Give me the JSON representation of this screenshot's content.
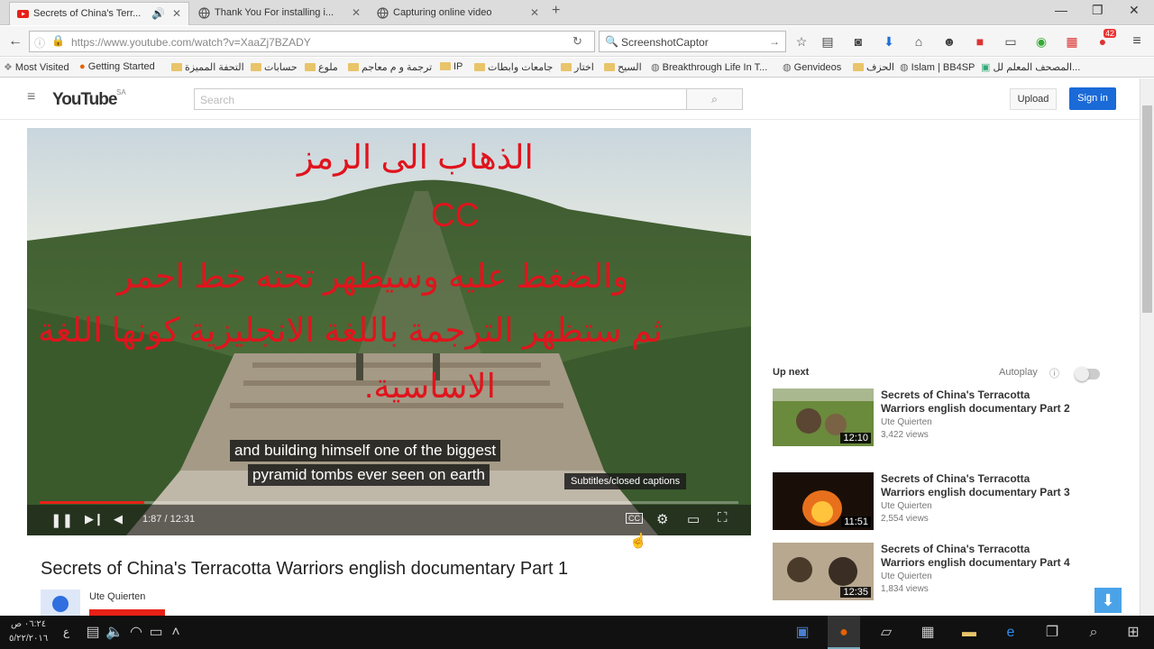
{
  "browser": {
    "tabs": [
      {
        "label": "Secrets of China's Terr...",
        "active": true
      },
      {
        "label": "Thank You For installing i...",
        "active": false
      },
      {
        "label": "Capturing online video",
        "active": false
      }
    ],
    "url": "https://www.youtube.com/watch?v=XaaZj7BZADY",
    "search_text": "ScreenshotCaptor",
    "notification_count": "42",
    "bookmarks": [
      "Most Visited",
      "Getting Started",
      "التحفة المميزة",
      "حسابات",
      "ملوع",
      "ترجمة و م معاجم",
      "IP",
      "جامعات وابطات",
      "اختار",
      "السيح",
      "Breakthrough Life In T...",
      "Genvideos",
      "الحزف",
      "Islam | BB4SP",
      "المصحف المعلم لل..."
    ]
  },
  "youtube": {
    "logo_text": "YouTube",
    "logo_region": "SA",
    "search_placeholder": "Search",
    "upload_label": "Upload",
    "signin_label": "Sign in"
  },
  "video": {
    "overlay_lines": [
      "الذهاب الى الرمز",
      "CC",
      "والضغط عليه وسيظهر تحته خط احمر",
      "ثم ستظهر الترجمة باللغة الانجليزية كونها اللغة",
      "الاساسية."
    ],
    "subtitle_line1": "and building himself one of the biggest",
    "subtitle_line2": "pyramid tombs ever seen on earth",
    "tooltip": "Subtitles/closed captions",
    "time": "1:87 / 12:31",
    "progress": 0.15,
    "title": "Secrets of China's Terracotta Warriors english documentary Part 1",
    "channel": "Ute Quierten"
  },
  "sidebar": {
    "up_next_label": "Up next",
    "autoplay_label": "Autoplay",
    "related": [
      {
        "title": "Secrets of China's Terracotta Warriors english documentary Part 2",
        "channel": "Ute Quierten",
        "views": "3,422 views",
        "duration": "12:10"
      },
      {
        "title": "Secrets of China's Terracotta Warriors english documentary Part 3",
        "channel": "Ute Quierten",
        "views": "2,554 views",
        "duration": "11:51"
      },
      {
        "title": "Secrets of China's Terracotta Warriors english documentary Part 4",
        "channel": "Ute Quierten",
        "views": "1,834 views",
        "duration": "12:35"
      }
    ]
  },
  "taskbar": {
    "time": "٠٦:٢٤ ص",
    "date": "٥/٢٢/٢٠١٦",
    "lang": "ع"
  }
}
